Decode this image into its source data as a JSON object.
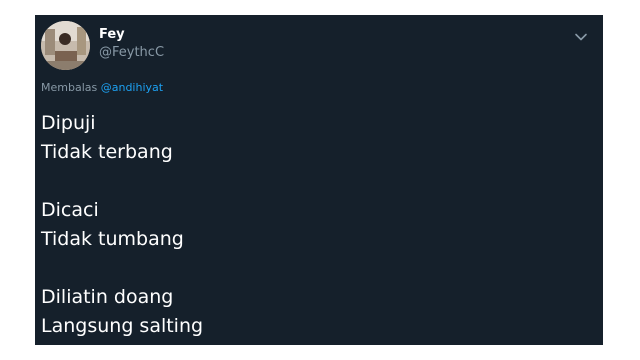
{
  "tweet": {
    "display_name": "Fey",
    "handle": "@FeythcC",
    "reply_prefix": "Membalas",
    "reply_mention": "@andihiyat",
    "stanzas": [
      [
        "Dipuji",
        "Tidak terbang"
      ],
      [
        "Dicaci",
        "Tidak tumbang"
      ],
      [
        "Diliatin doang",
        "Langsung salting"
      ]
    ]
  },
  "icons": {
    "menu": "chevron-down-icon",
    "avatar": "avatar-photo"
  },
  "colors": {
    "background": "#15202b",
    "text": "#ffffff",
    "secondary_text": "#8899a6",
    "link": "#1da1f2",
    "page": "#ffffff"
  }
}
